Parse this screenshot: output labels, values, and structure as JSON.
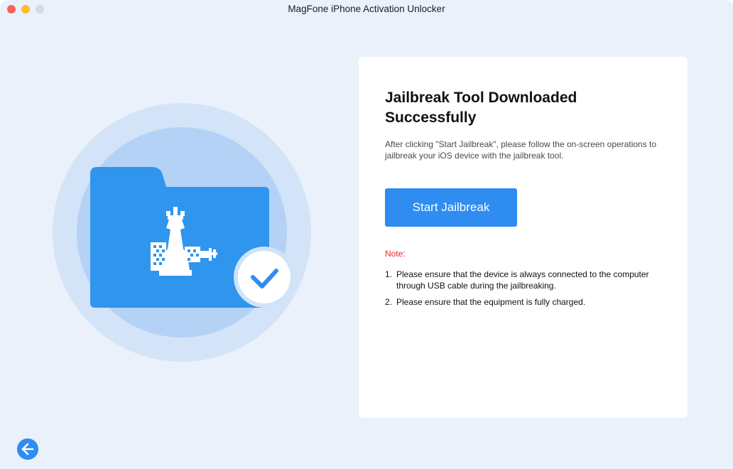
{
  "window": {
    "title": "MagFone iPhone Activation Unlocker"
  },
  "illustration": {
    "folder_color": "#2f95ee",
    "check_color": "#2f8cf0",
    "icons": [
      "folder-icon",
      "chess-rook-icon",
      "checkmark-icon"
    ]
  },
  "card": {
    "title": "Jailbreak Tool Downloaded Successfully",
    "description": "After clicking \"Start Jailbreak\", please follow the on-screen operations to jailbreak your iOS device with the jailbreak tool.",
    "start_button_label": "Start Jailbreak",
    "note_label": "Note:",
    "notes": [
      {
        "num": "1.",
        "text": "Please ensure that the device is always connected to the computer through USB cable during the jailbreaking."
      },
      {
        "num": "2.",
        "text": "Please ensure that the equipment is fully charged."
      }
    ]
  },
  "footer": {
    "back_icon": "arrow-left-icon"
  },
  "colors": {
    "accent": "#2f8cf0",
    "note_red": "#e8262c",
    "background": "#eaf1fb"
  }
}
